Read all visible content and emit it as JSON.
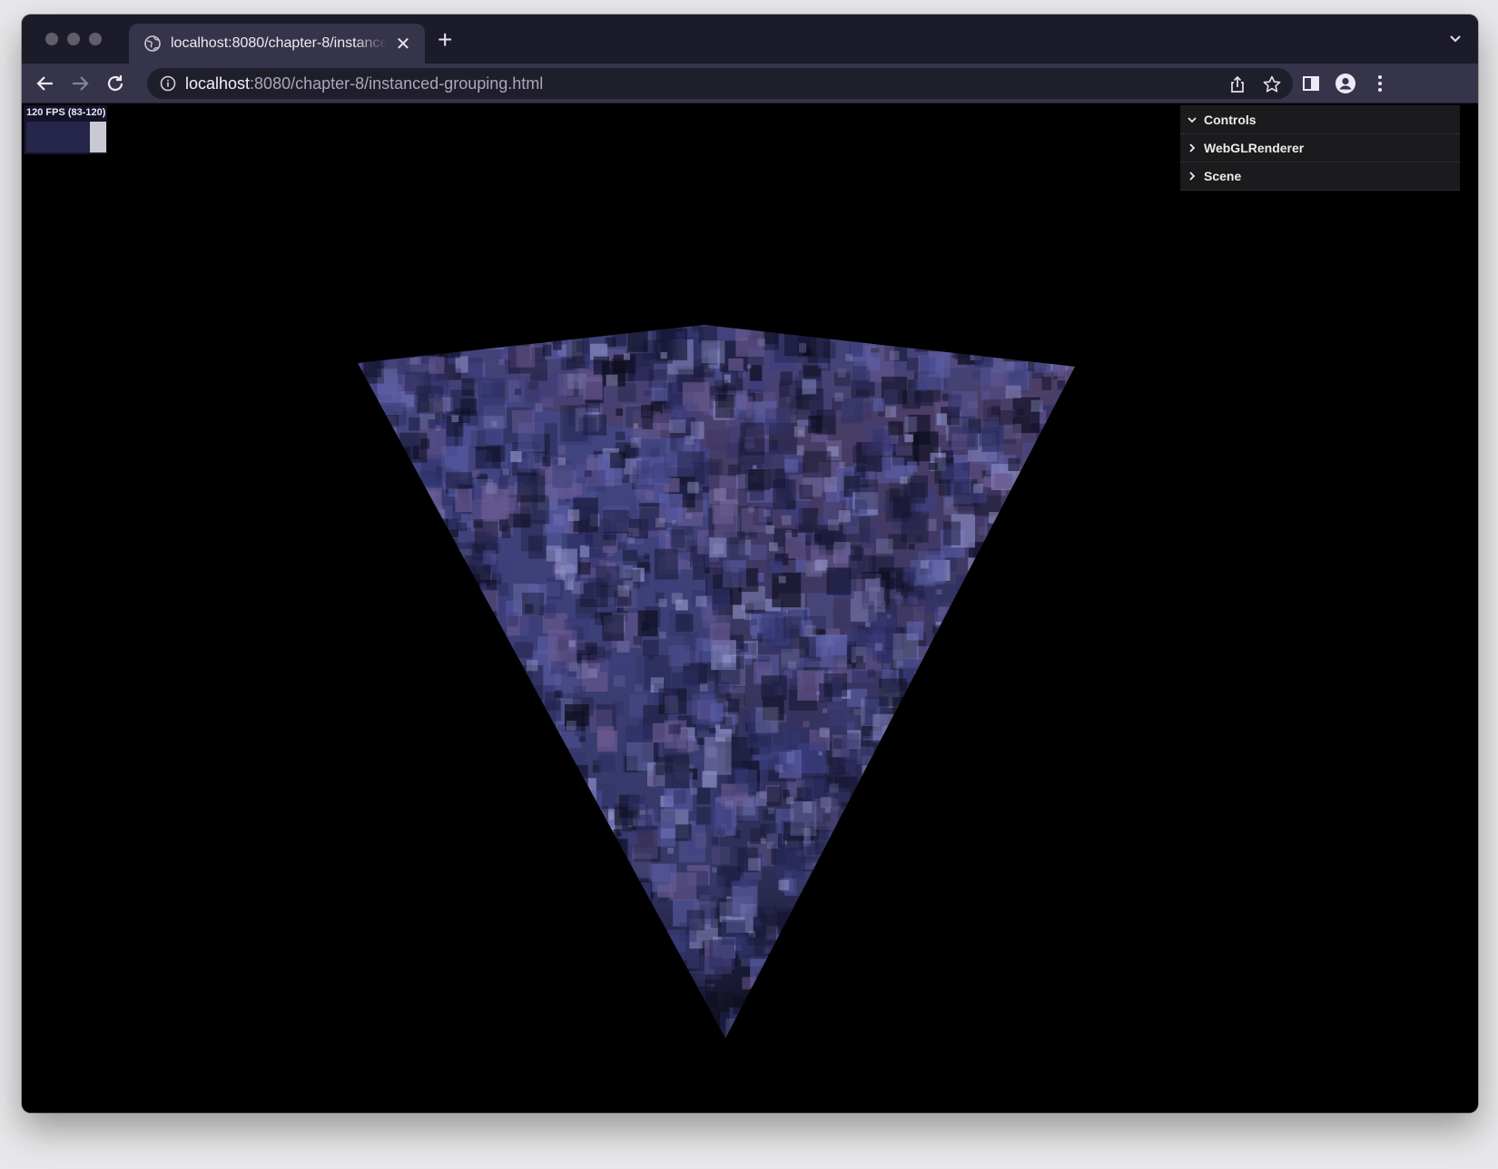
{
  "browser": {
    "tab": {
      "title": "localhost:8080/chapter-8/instanced-grouping.html"
    },
    "address": {
      "host": "localhost",
      "path": ":8080/chapter-8/instanced-grouping.html"
    }
  },
  "stats": {
    "label": "120 FPS (83-120)",
    "current_fps": 120,
    "min_fps": 83,
    "max_fps": 120
  },
  "gui": {
    "title": "Controls",
    "folders": [
      "WebGLRenderer",
      "Scene"
    ]
  },
  "colors": {
    "tab_strip": "#1c1b29",
    "toolbar": "#36344a",
    "viewport_bg": "#000000",
    "cube_blue": "#4c4f93",
    "cube_purple": "#5a4a7a",
    "cube_highlight": "#9a9cc8"
  }
}
